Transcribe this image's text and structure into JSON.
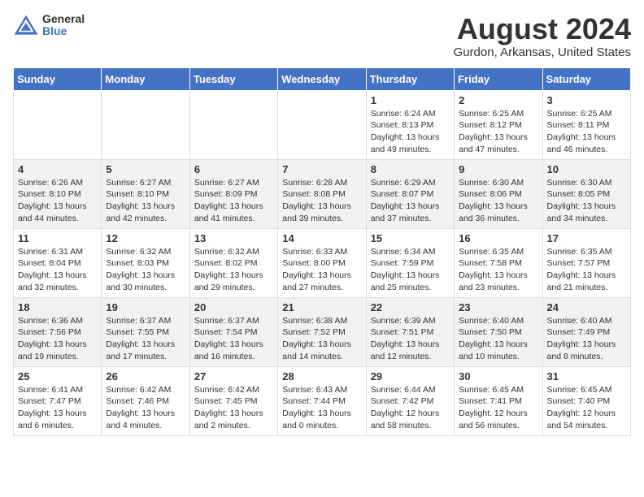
{
  "logo": {
    "general": "General",
    "blue": "Blue"
  },
  "header": {
    "month_title": "August 2024",
    "location": "Gurdon, Arkansas, United States"
  },
  "weekdays": [
    "Sunday",
    "Monday",
    "Tuesday",
    "Wednesday",
    "Thursday",
    "Friday",
    "Saturday"
  ],
  "weeks": [
    [
      {
        "day": "",
        "info": ""
      },
      {
        "day": "",
        "info": ""
      },
      {
        "day": "",
        "info": ""
      },
      {
        "day": "",
        "info": ""
      },
      {
        "day": "1",
        "info": "Sunrise: 6:24 AM\nSunset: 8:13 PM\nDaylight: 13 hours\nand 49 minutes."
      },
      {
        "day": "2",
        "info": "Sunrise: 6:25 AM\nSunset: 8:12 PM\nDaylight: 13 hours\nand 47 minutes."
      },
      {
        "day": "3",
        "info": "Sunrise: 6:25 AM\nSunset: 8:11 PM\nDaylight: 13 hours\nand 46 minutes."
      }
    ],
    [
      {
        "day": "4",
        "info": "Sunrise: 6:26 AM\nSunset: 8:10 PM\nDaylight: 13 hours\nand 44 minutes."
      },
      {
        "day": "5",
        "info": "Sunrise: 6:27 AM\nSunset: 8:10 PM\nDaylight: 13 hours\nand 42 minutes."
      },
      {
        "day": "6",
        "info": "Sunrise: 6:27 AM\nSunset: 8:09 PM\nDaylight: 13 hours\nand 41 minutes."
      },
      {
        "day": "7",
        "info": "Sunrise: 6:28 AM\nSunset: 8:08 PM\nDaylight: 13 hours\nand 39 minutes."
      },
      {
        "day": "8",
        "info": "Sunrise: 6:29 AM\nSunset: 8:07 PM\nDaylight: 13 hours\nand 37 minutes."
      },
      {
        "day": "9",
        "info": "Sunrise: 6:30 AM\nSunset: 8:06 PM\nDaylight: 13 hours\nand 36 minutes."
      },
      {
        "day": "10",
        "info": "Sunrise: 6:30 AM\nSunset: 8:05 PM\nDaylight: 13 hours\nand 34 minutes."
      }
    ],
    [
      {
        "day": "11",
        "info": "Sunrise: 6:31 AM\nSunset: 8:04 PM\nDaylight: 13 hours\nand 32 minutes."
      },
      {
        "day": "12",
        "info": "Sunrise: 6:32 AM\nSunset: 8:03 PM\nDaylight: 13 hours\nand 30 minutes."
      },
      {
        "day": "13",
        "info": "Sunrise: 6:32 AM\nSunset: 8:02 PM\nDaylight: 13 hours\nand 29 minutes."
      },
      {
        "day": "14",
        "info": "Sunrise: 6:33 AM\nSunset: 8:00 PM\nDaylight: 13 hours\nand 27 minutes."
      },
      {
        "day": "15",
        "info": "Sunrise: 6:34 AM\nSunset: 7:59 PM\nDaylight: 13 hours\nand 25 minutes."
      },
      {
        "day": "16",
        "info": "Sunrise: 6:35 AM\nSunset: 7:58 PM\nDaylight: 13 hours\nand 23 minutes."
      },
      {
        "day": "17",
        "info": "Sunrise: 6:35 AM\nSunset: 7:57 PM\nDaylight: 13 hours\nand 21 minutes."
      }
    ],
    [
      {
        "day": "18",
        "info": "Sunrise: 6:36 AM\nSunset: 7:56 PM\nDaylight: 13 hours\nand 19 minutes."
      },
      {
        "day": "19",
        "info": "Sunrise: 6:37 AM\nSunset: 7:55 PM\nDaylight: 13 hours\nand 17 minutes."
      },
      {
        "day": "20",
        "info": "Sunrise: 6:37 AM\nSunset: 7:54 PM\nDaylight: 13 hours\nand 16 minutes."
      },
      {
        "day": "21",
        "info": "Sunrise: 6:38 AM\nSunset: 7:52 PM\nDaylight: 13 hours\nand 14 minutes."
      },
      {
        "day": "22",
        "info": "Sunrise: 6:39 AM\nSunset: 7:51 PM\nDaylight: 13 hours\nand 12 minutes."
      },
      {
        "day": "23",
        "info": "Sunrise: 6:40 AM\nSunset: 7:50 PM\nDaylight: 13 hours\nand 10 minutes."
      },
      {
        "day": "24",
        "info": "Sunrise: 6:40 AM\nSunset: 7:49 PM\nDaylight: 13 hours\nand 8 minutes."
      }
    ],
    [
      {
        "day": "25",
        "info": "Sunrise: 6:41 AM\nSunset: 7:47 PM\nDaylight: 13 hours\nand 6 minutes."
      },
      {
        "day": "26",
        "info": "Sunrise: 6:42 AM\nSunset: 7:46 PM\nDaylight: 13 hours\nand 4 minutes."
      },
      {
        "day": "27",
        "info": "Sunrise: 6:42 AM\nSunset: 7:45 PM\nDaylight: 13 hours\nand 2 minutes."
      },
      {
        "day": "28",
        "info": "Sunrise: 6:43 AM\nSunset: 7:44 PM\nDaylight: 13 hours\nand 0 minutes."
      },
      {
        "day": "29",
        "info": "Sunrise: 6:44 AM\nSunset: 7:42 PM\nDaylight: 12 hours\nand 58 minutes."
      },
      {
        "day": "30",
        "info": "Sunrise: 6:45 AM\nSunset: 7:41 PM\nDaylight: 12 hours\nand 56 minutes."
      },
      {
        "day": "31",
        "info": "Sunrise: 6:45 AM\nSunset: 7:40 PM\nDaylight: 12 hours\nand 54 minutes."
      }
    ]
  ]
}
